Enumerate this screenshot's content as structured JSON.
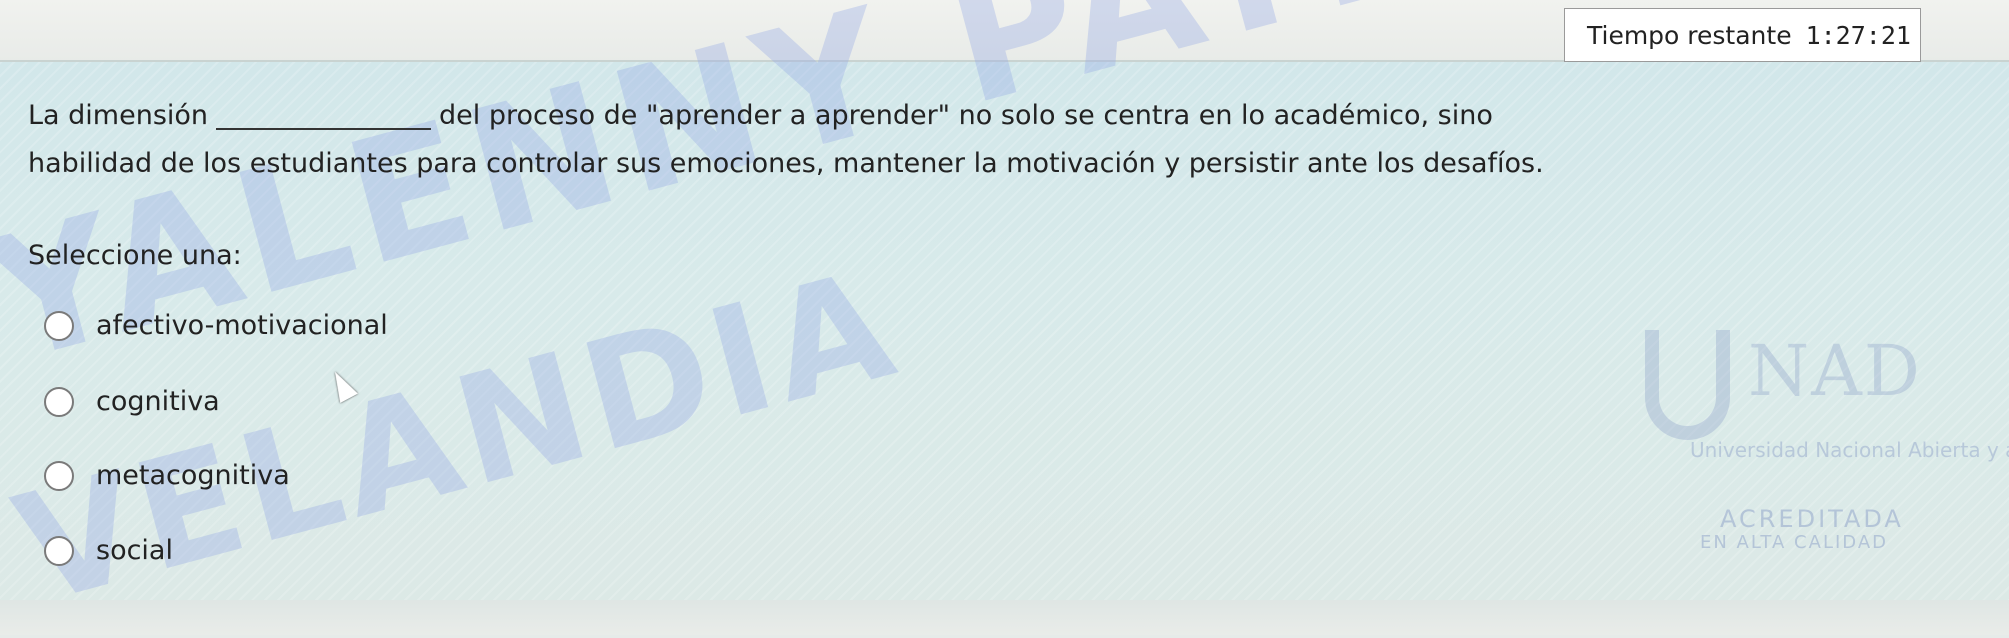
{
  "timer": {
    "label": "Tiempo restante",
    "value": "1:27:21"
  },
  "question": {
    "line1_start": "La dimensión",
    "line1_end": "del proceso de \"aprender a aprender\" no solo se centra en lo académico, sino",
    "line2": "habilidad de los estudiantes para controlar sus emociones, mantener la motivación y persistir ante los desafíos."
  },
  "select_prompt": "Seleccione una:",
  "options": [
    {
      "label": "afectivo-motivacional",
      "selected": false
    },
    {
      "label": "cognitiva",
      "selected": false
    },
    {
      "label": "metacognitiva",
      "selected": false
    },
    {
      "label": "social",
      "selected": false
    }
  ],
  "watermark": {
    "line1": "YALENNY PATRICIA LARA",
    "line2": "VELANDIA"
  },
  "logo": {
    "letters": "NAD",
    "subtitle": "Universidad Nacional Abierta y a Distancia",
    "accreditation": "ACREDITADA",
    "accreditation_sub": "EN ALTA CALIDAD"
  }
}
